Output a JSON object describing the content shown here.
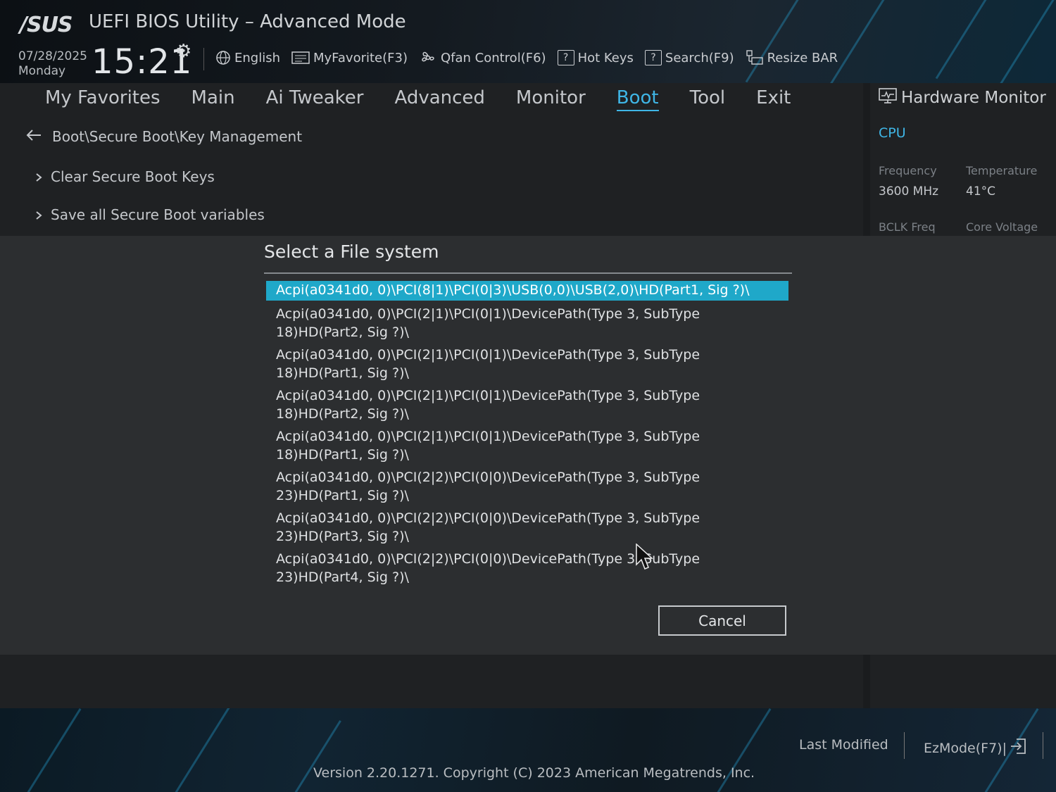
{
  "header": {
    "logo": "/SUS",
    "title": "UEFI BIOS Utility – Advanced Mode",
    "date": "07/28/2025",
    "day": "Monday",
    "time": "15:21",
    "toolbar": [
      {
        "label": "English",
        "icon": "globe-icon"
      },
      {
        "label": "MyFavorite(F3)",
        "icon": "favorite-icon"
      },
      {
        "label": "Qfan Control(F6)",
        "icon": "fan-icon"
      },
      {
        "label": "Hot Keys",
        "icon": "help-icon"
      },
      {
        "label": "Search(F9)",
        "icon": "help-icon"
      },
      {
        "label": "Resize BAR",
        "icon": "resize-bar-icon"
      }
    ]
  },
  "nav": {
    "tabs": [
      "My Favorites",
      "Main",
      "Ai Tweaker",
      "Advanced",
      "Monitor",
      "Boot",
      "Tool",
      "Exit"
    ],
    "active": "Boot"
  },
  "breadcrumb": "Boot\\Secure Boot\\Key Management",
  "menu": [
    {
      "label": "Clear Secure Boot Keys"
    },
    {
      "label": "Save all Secure Boot variables"
    }
  ],
  "hardware_monitor": {
    "title": "Hardware Monitor",
    "category": "CPU",
    "frequency_label": "Frequency",
    "frequency_value": "3600 MHz",
    "temperature_label": "Temperature",
    "temperature_value": "41°C",
    "bclk_label": "BCLK Freq",
    "core_voltage_label": "Core Voltage"
  },
  "dialog": {
    "title": "Select a File system",
    "items": [
      "Acpi(a0341d0, 0)\\PCI(8|1)\\PCI(0|3)\\USB(0,0)\\USB(2,0)\\HD(Part1, Sig ?)\\",
      "Acpi(a0341d0, 0)\\PCI(2|1)\\PCI(0|1)\\DevicePath(Type 3, SubType 18)HD(Part2, Sig ?)\\",
      "Acpi(a0341d0, 0)\\PCI(2|1)\\PCI(0|1)\\DevicePath(Type 3, SubType 18)HD(Part1, Sig ?)\\",
      "Acpi(a0341d0, 0)\\PCI(2|1)\\PCI(0|1)\\DevicePath(Type 3, SubType 18)HD(Part2, Sig ?)\\",
      "Acpi(a0341d0, 0)\\PCI(2|1)\\PCI(0|1)\\DevicePath(Type 3, SubType 18)HD(Part1, Sig ?)\\",
      "Acpi(a0341d0, 0)\\PCI(2|2)\\PCI(0|0)\\DevicePath(Type 3, SubType 23)HD(Part1, Sig ?)\\",
      "Acpi(a0341d0, 0)\\PCI(2|2)\\PCI(0|0)\\DevicePath(Type 3, SubType 23)HD(Part3, Sig ?)\\",
      "Acpi(a0341d0, 0)\\PCI(2|2)\\PCI(0|0)\\DevicePath(Type 3, SubType 23)HD(Part4, Sig ?)\\"
    ],
    "selected_index": 0,
    "cancel_label": "Cancel"
  },
  "footer": {
    "version": "Version 2.20.1271. Copyright (C) 2023 American Megatrends, Inc.",
    "last_modified": "Last Modified",
    "ezmode": "EzMode(F7)|"
  },
  "colors": {
    "accent": "#3fb6e6",
    "selection": "#1fa8c9",
    "background": "#1f2123",
    "dialog_band": "#2c2e30"
  }
}
